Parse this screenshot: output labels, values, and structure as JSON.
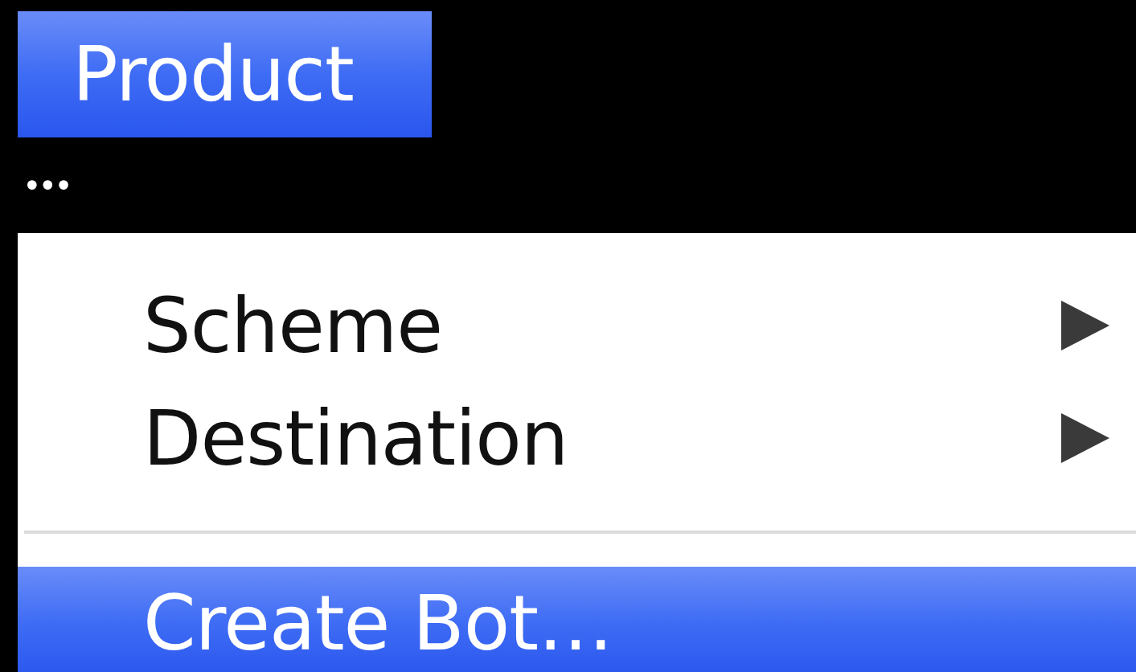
{
  "menu_bar": {
    "title": {
      "label": "Product",
      "selected": true
    },
    "overflow": "•••"
  },
  "menu": {
    "items": [
      {
        "kind": "item",
        "label": "Scheme",
        "submenu": true,
        "selected": false
      },
      {
        "kind": "item",
        "label": "Destination",
        "submenu": true,
        "selected": false
      },
      {
        "kind": "separator"
      },
      {
        "kind": "item",
        "label": "Create Bot…",
        "submenu": false,
        "selected": true
      }
    ]
  }
}
